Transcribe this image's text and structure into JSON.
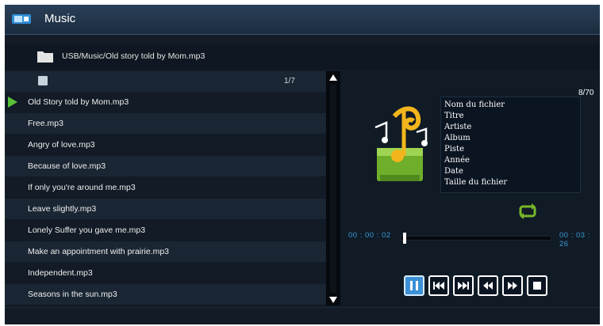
{
  "header": {
    "title": "Music"
  },
  "path": {
    "text": "USB/Music/Old story told by Mom.mp3"
  },
  "list": {
    "page_count": "1/7",
    "items": [
      {
        "label": "Old Story told by Mom.mp3"
      },
      {
        "label": "Free.mp3"
      },
      {
        "label": "Angry of love.mp3"
      },
      {
        "label": "Because of love.mp3"
      },
      {
        "label": "If only you're around me.mp3"
      },
      {
        "label": "Leave slightly.mp3"
      },
      {
        "label": "Lonely Suffer you gave me.mp3"
      },
      {
        "label": "Make an appointment with prairie.mp3"
      },
      {
        "label": "Independent.mp3"
      },
      {
        "label": "Seasons in the sun.mp3"
      }
    ]
  },
  "player": {
    "track_count": "8/70",
    "info_labels": [
      "Nom du fichier",
      "Titre",
      "Artiste",
      "Album",
      "Piste",
      "Année",
      "Date",
      "Taille du fichier"
    ],
    "current_time": "00 : 00 : 02",
    "total_time": "00 : 03 : 26",
    "progress_fraction": 0.01
  },
  "icons": {
    "app": "music-app-icon",
    "folder": "folder-icon",
    "list": "list-icon",
    "playing": "play-indicator-icon",
    "repeat": "repeat-icon",
    "controls": [
      "pause-icon",
      "previous-track-icon",
      "next-track-icon",
      "rewind-icon",
      "fast-forward-icon",
      "stop-icon"
    ]
  },
  "colors": {
    "accent": "#3b90d6",
    "playing": "#58c23a",
    "time": "#3b9ad6"
  }
}
